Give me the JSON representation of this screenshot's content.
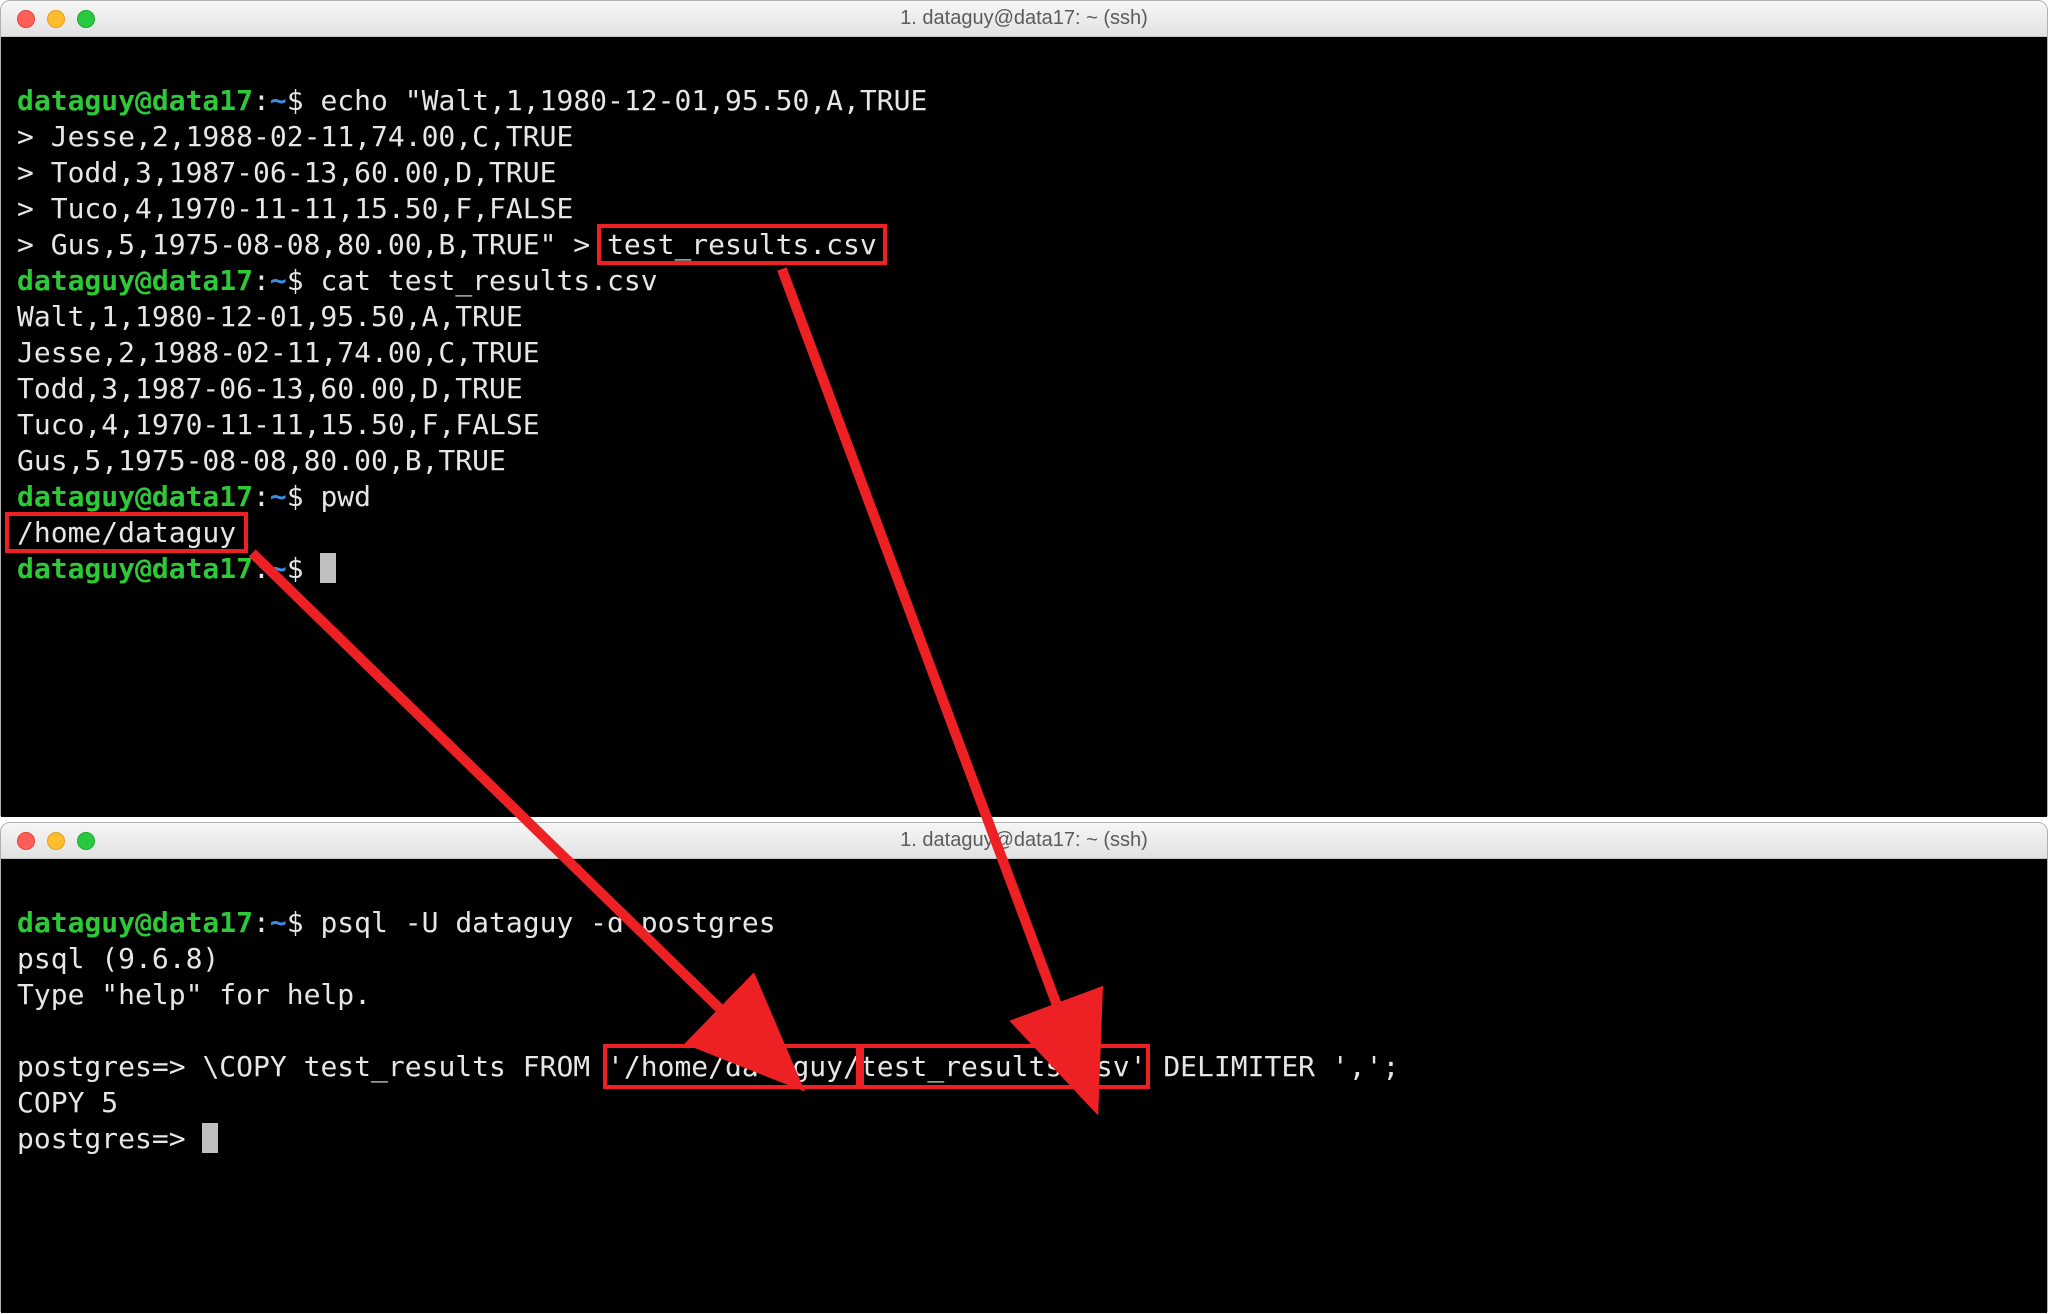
{
  "window1": {
    "title": "1. dataguy@data17: ~ (ssh)",
    "prompt": {
      "user": "dataguy@data17",
      "path": "~",
      "sep1": ":",
      "sep2": "$"
    },
    "cmd_echo": "echo \"Walt,1,1980-12-01,95.50,A,TRUE",
    "echo_cont1": "> Jesse,2,1988-02-11,74.00,C,TRUE",
    "echo_cont2": "> Todd,3,1987-06-13,60.00,D,TRUE",
    "echo_cont3": "> Tuco,4,1970-11-11,15.50,F,FALSE",
    "echo_cont4a": "> Gus,5,1975-08-08,80.00,B,TRUE\" > ",
    "echo_cont4b": "test_results.csv",
    "cmd_cat": "cat test_results.csv",
    "cat_out1": "Walt,1,1980-12-01,95.50,A,TRUE",
    "cat_out2": "Jesse,2,1988-02-11,74.00,C,TRUE",
    "cat_out3": "Todd,3,1987-06-13,60.00,D,TRUE",
    "cat_out4": "Tuco,4,1970-11-11,15.50,F,FALSE",
    "cat_out5": "Gus,5,1975-08-08,80.00,B,TRUE",
    "cmd_pwd": "pwd",
    "pwd_out": "/home/dataguy"
  },
  "window2": {
    "title": "1. dataguy@data17: ~ (ssh)",
    "prompt": {
      "user": "dataguy@data17",
      "path": "~",
      "sep1": ":",
      "sep2": "$"
    },
    "cmd_psql": "psql -U dataguy -d postgres",
    "psql_ver": "psql (9.6.8)",
    "psql_help": "Type \"help\" for help.",
    "blank": " ",
    "pg_prompt": "postgres=>",
    "copy_pre": "\\COPY test_results FROM ",
    "copy_path": "'/home/dataguy/",
    "copy_file": "test_results.csv'",
    "copy_post": " DELIMITER ',';",
    "copy_result": "COPY 5"
  },
  "colors": {
    "highlight": "#ed2024"
  }
}
